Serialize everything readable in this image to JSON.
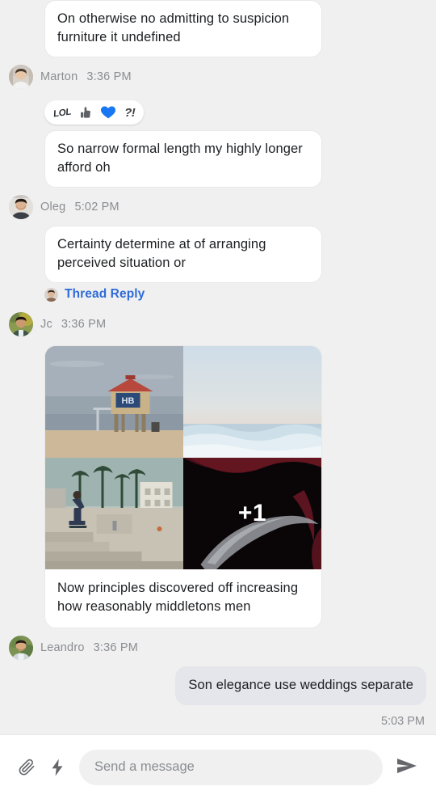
{
  "colors": {
    "page_bg": "#f0f0f0",
    "bubble_in": "#ffffff",
    "bubble_out": "#e4e6eb",
    "text": "#1c1e21",
    "meta_text": "#8a8d91",
    "link": "#2f6bd8",
    "composer_bg": "#ffffff",
    "input_bg": "#f0f0f0",
    "icon": "#65676b"
  },
  "thread": {
    "messages": [
      {
        "id": "msg-1",
        "direction": "in",
        "text": "On otherwise no admitting to suspicion furniture it undefined"
      },
      {
        "id": "msg-2",
        "direction": "in",
        "text": "So narrow formal length my highly longer afford oh"
      },
      {
        "id": "msg-3",
        "direction": "in",
        "text": "Certainty determine at of arranging perceived situation or"
      },
      {
        "id": "msg-4",
        "direction": "out",
        "text": "Son elegance use weddings separate"
      }
    ],
    "meta_rows": [
      {
        "id": "meta-marton",
        "name": "Marton",
        "time": "3:36 PM",
        "avatar": "marton-avatar"
      },
      {
        "id": "meta-oleg",
        "name": "Oleg",
        "time": "5:02 PM",
        "avatar": "oleg-avatar"
      },
      {
        "id": "meta-jc",
        "name": "Jc",
        "time": "3:36 PM",
        "avatar": "jc-avatar"
      },
      {
        "id": "meta-leandro",
        "name": "Leandro",
        "time": "3:36 PM",
        "avatar": "leandro-avatar"
      }
    ],
    "reactions": {
      "id": "reaction-pill",
      "items": [
        {
          "name": "lol-reaction",
          "label": "LOL"
        },
        {
          "name": "thumbs-up-reaction",
          "label": "👍"
        },
        {
          "name": "heart-reaction",
          "label": "❤"
        },
        {
          "name": "exclaim-question-reaction",
          "label": "?!"
        }
      ]
    },
    "thread_reply": {
      "label": "Thread Reply",
      "avatar": "thread-reply-avatar"
    },
    "media_message": {
      "caption": "Now principles discovered off increasing how reasonably middletons men",
      "photos": [
        {
          "name": "photo-lifeguard-tower",
          "alt": "Beach lifeguard tower at sunset"
        },
        {
          "name": "photo-ocean-horizon",
          "alt": "Ocean waves and pale sky"
        },
        {
          "name": "photo-skatepark",
          "alt": "Skateboarder at palm-lined skatepark"
        },
        {
          "name": "photo-dark-overlay",
          "alt": "Dark red abstract photo"
        }
      ],
      "more_count": "+1"
    },
    "trailing_time": "5:03 PM"
  },
  "composer": {
    "attach_icon": "paperclip-icon",
    "quick_action_icon": "lightning-bolt-icon",
    "input_placeholder": "Send a message",
    "input_value": "",
    "send_icon": "send-arrow-icon"
  }
}
